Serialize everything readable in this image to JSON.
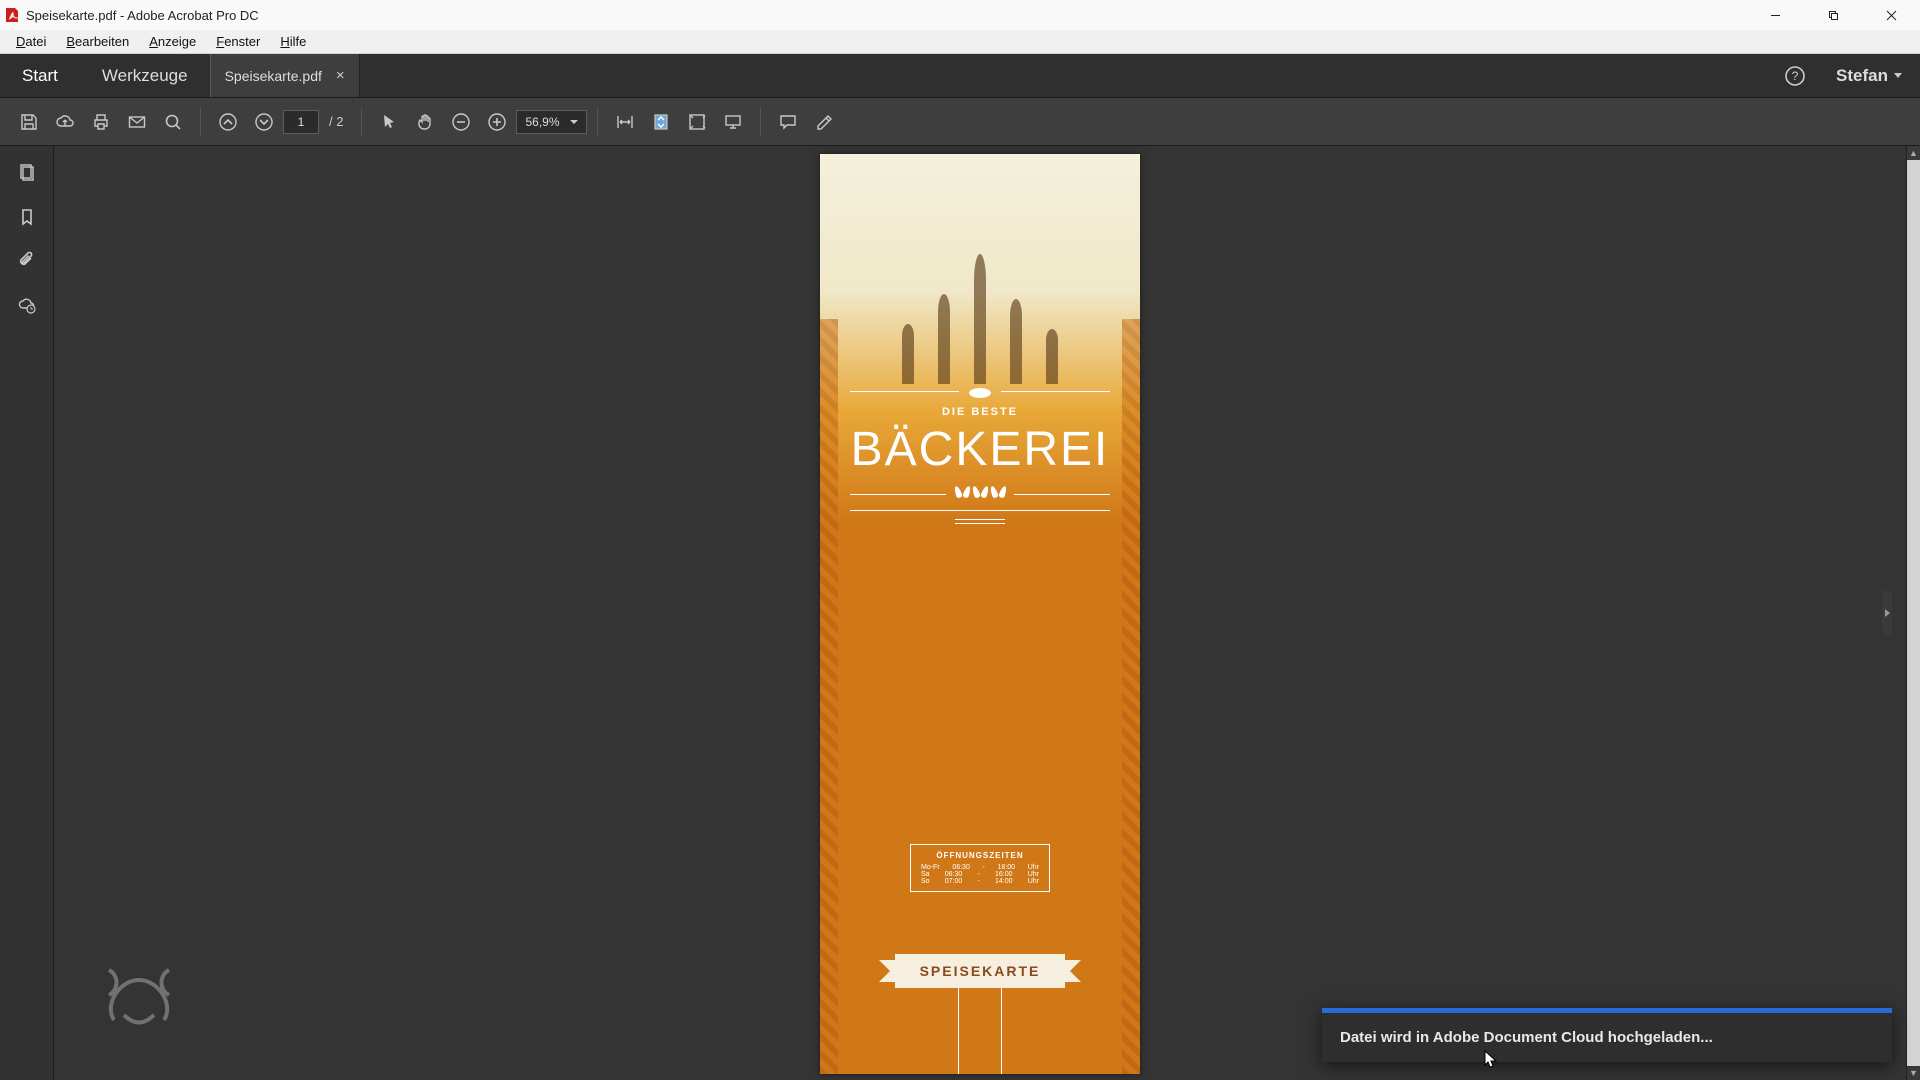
{
  "titlebar": {
    "title": "Speisekarte.pdf - Adobe Acrobat Pro DC"
  },
  "menu": {
    "items": [
      "Datei",
      "Bearbeiten",
      "Anzeige",
      "Fenster",
      "Hilfe"
    ]
  },
  "tabs": {
    "start": "Start",
    "tools": "Werkzeuge",
    "doc": "Speisekarte.pdf",
    "user": "Stefan"
  },
  "toolbar": {
    "page_current": "1",
    "page_sep": "/",
    "page_total": "2",
    "zoom": "56,9%"
  },
  "document": {
    "subtitle": "DIE BESTE",
    "title": "BÄCKEREI",
    "hours_title": "ÖFFNUNGSZEITEN",
    "hours": [
      {
        "day": "Mo-Fr",
        "from": "06:30",
        "sep": "-",
        "to": "18:00",
        "unit": "Uhr"
      },
      {
        "day": "Sa",
        "from": "06:30",
        "sep": "-",
        "to": "16:00",
        "unit": "Uhr"
      },
      {
        "day": "So",
        "from": "07:00",
        "sep": "-",
        "to": "14:00",
        "unit": "Uhr"
      }
    ],
    "ribbon": "SPEISEKARTE"
  },
  "toast": {
    "message": "Datei wird in Adobe Document Cloud hochgeladen..."
  }
}
